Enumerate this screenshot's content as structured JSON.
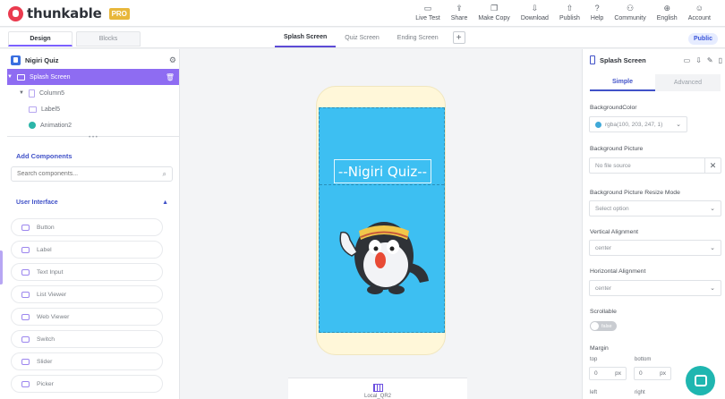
{
  "brand": {
    "name": "thunkable",
    "tier": "PRO"
  },
  "nav": [
    {
      "label": "Live Test",
      "icon": "live-test-icon",
      "glyph": "▭"
    },
    {
      "label": "Share",
      "icon": "share-icon",
      "glyph": "⇪"
    },
    {
      "label": "Make Copy",
      "icon": "copy-icon",
      "glyph": "❐"
    },
    {
      "label": "Download",
      "icon": "download-icon",
      "glyph": "⇩"
    },
    {
      "label": "Publish",
      "icon": "publish-icon",
      "glyph": "⇧"
    },
    {
      "label": "Help",
      "icon": "help-icon",
      "glyph": "?"
    },
    {
      "label": "Community",
      "icon": "community-icon",
      "glyph": "⚇"
    },
    {
      "label": "English",
      "icon": "globe-icon",
      "glyph": "⊕"
    },
    {
      "label": "Account",
      "icon": "account-icon",
      "glyph": "☺"
    }
  ],
  "editor_tabs": {
    "design": "Design",
    "blocks": "Blocks"
  },
  "screens": [
    "Splash Screen",
    "Quiz Screen",
    "Ending Screen"
  ],
  "public_label": "Public",
  "project": {
    "name": "Nigiri Quiz"
  },
  "tree": {
    "root": "Splash Screen",
    "column": "Column5",
    "label": "Label5",
    "animation": "Animation2"
  },
  "components": {
    "heading": "Add Components",
    "search_placeholder": "Search components...",
    "section": "User Interface",
    "items": [
      "Button",
      "Label",
      "Text Input",
      "List Viewer",
      "Web Viewer",
      "Switch",
      "Slider",
      "Picker"
    ]
  },
  "canvas": {
    "title_text": "--Nigiri Quiz--",
    "bottom_label": "Local_QR2"
  },
  "properties": {
    "header": "Splash Screen",
    "tabs": {
      "simple": "Simple",
      "advanced": "Advanced"
    },
    "background_color_label": "BackgroundColor",
    "background_color_value": "rgba(100, 203, 247, 1)",
    "background_picture_label": "Background Picture",
    "background_picture_value": "No file source",
    "resize_mode_label": "Background Picture Resize Mode",
    "resize_mode_value": "Select option",
    "vertical_label": "Vertical Alignment",
    "vertical_value": "center",
    "horizontal_label": "Horizontal Alignment",
    "horizontal_value": "center",
    "scrollable_label": "Scrollable",
    "scrollable_value": "false",
    "margin_label": "Margin",
    "margin_top_label": "top",
    "margin_bottom_label": "bottom",
    "margin_top_value": "0",
    "margin_bottom_value": "0",
    "margin_unit": "px",
    "margin_left_label": "left",
    "margin_right_label": "right"
  },
  "colors": {
    "accent": "#8e6cf2",
    "screen_bg": "#3dbff2",
    "phone_frame": "#fff7d9",
    "link_blue": "#4152c8",
    "chat": "#1fb6b0"
  }
}
